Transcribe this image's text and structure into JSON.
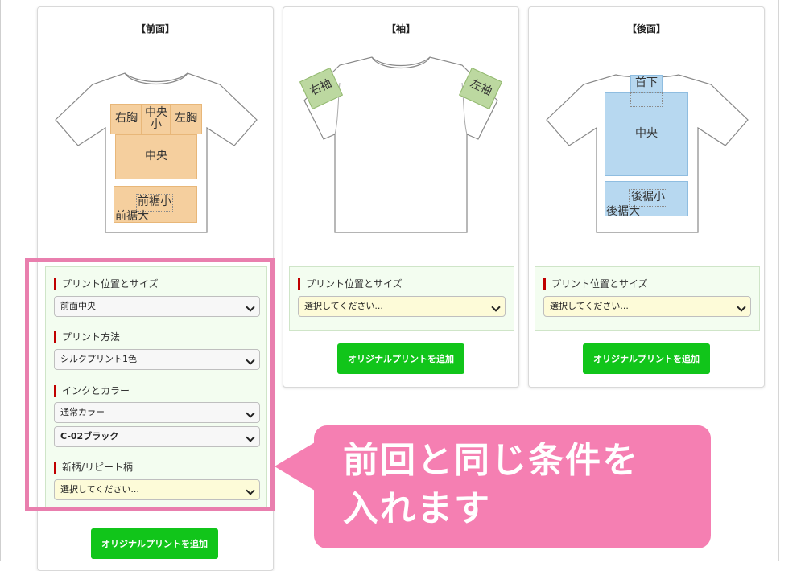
{
  "panels": {
    "front": {
      "title": "【前面】",
      "zones": {
        "right_chest": "右胸",
        "center_small": "中央\n小",
        "left_chest": "左胸",
        "center": "中央",
        "front_hem_small": "前裾小",
        "front_hem_large": "前裾大"
      },
      "position_label": "プリント位置とサイズ",
      "position_value": "前面中央",
      "method_label": "プリント方法",
      "method_value": "シルクプリント1色",
      "ink_label": "インクとカラー",
      "ink_type_value": "通常カラー",
      "ink_color_value": "C-02ブラック",
      "pattern_label": "新柄/リピート柄",
      "pattern_value": "選択してください...",
      "add_button": "オリジナルプリントを追加"
    },
    "sleeve": {
      "title": "【袖】",
      "zones": {
        "right_sleeve": "右袖",
        "left_sleeve": "左袖"
      },
      "position_label": "プリント位置とサイズ",
      "position_value": "選択してください...",
      "add_button": "オリジナルプリントを追加"
    },
    "back": {
      "title": "【後面】",
      "zones": {
        "neck": "首下",
        "center": "中央",
        "back_hem_small": "後裾小",
        "back_hem_large": "後裾大"
      },
      "position_label": "プリント位置とサイズ",
      "position_value": "選択してください...",
      "add_button": "オリジナルプリントを追加"
    }
  },
  "callout": {
    "line1": "前回と同じ条件を",
    "line2": "入れます"
  },
  "colors": {
    "highlight": "#e97fae",
    "callout_bg": "#f57fb2",
    "add_button": "#11c51a",
    "zone_front": "#f5cf9e",
    "zone_back": "#b7d8f0",
    "zone_sleeve": "#bcd8a0",
    "label_bar": "#c00000"
  }
}
